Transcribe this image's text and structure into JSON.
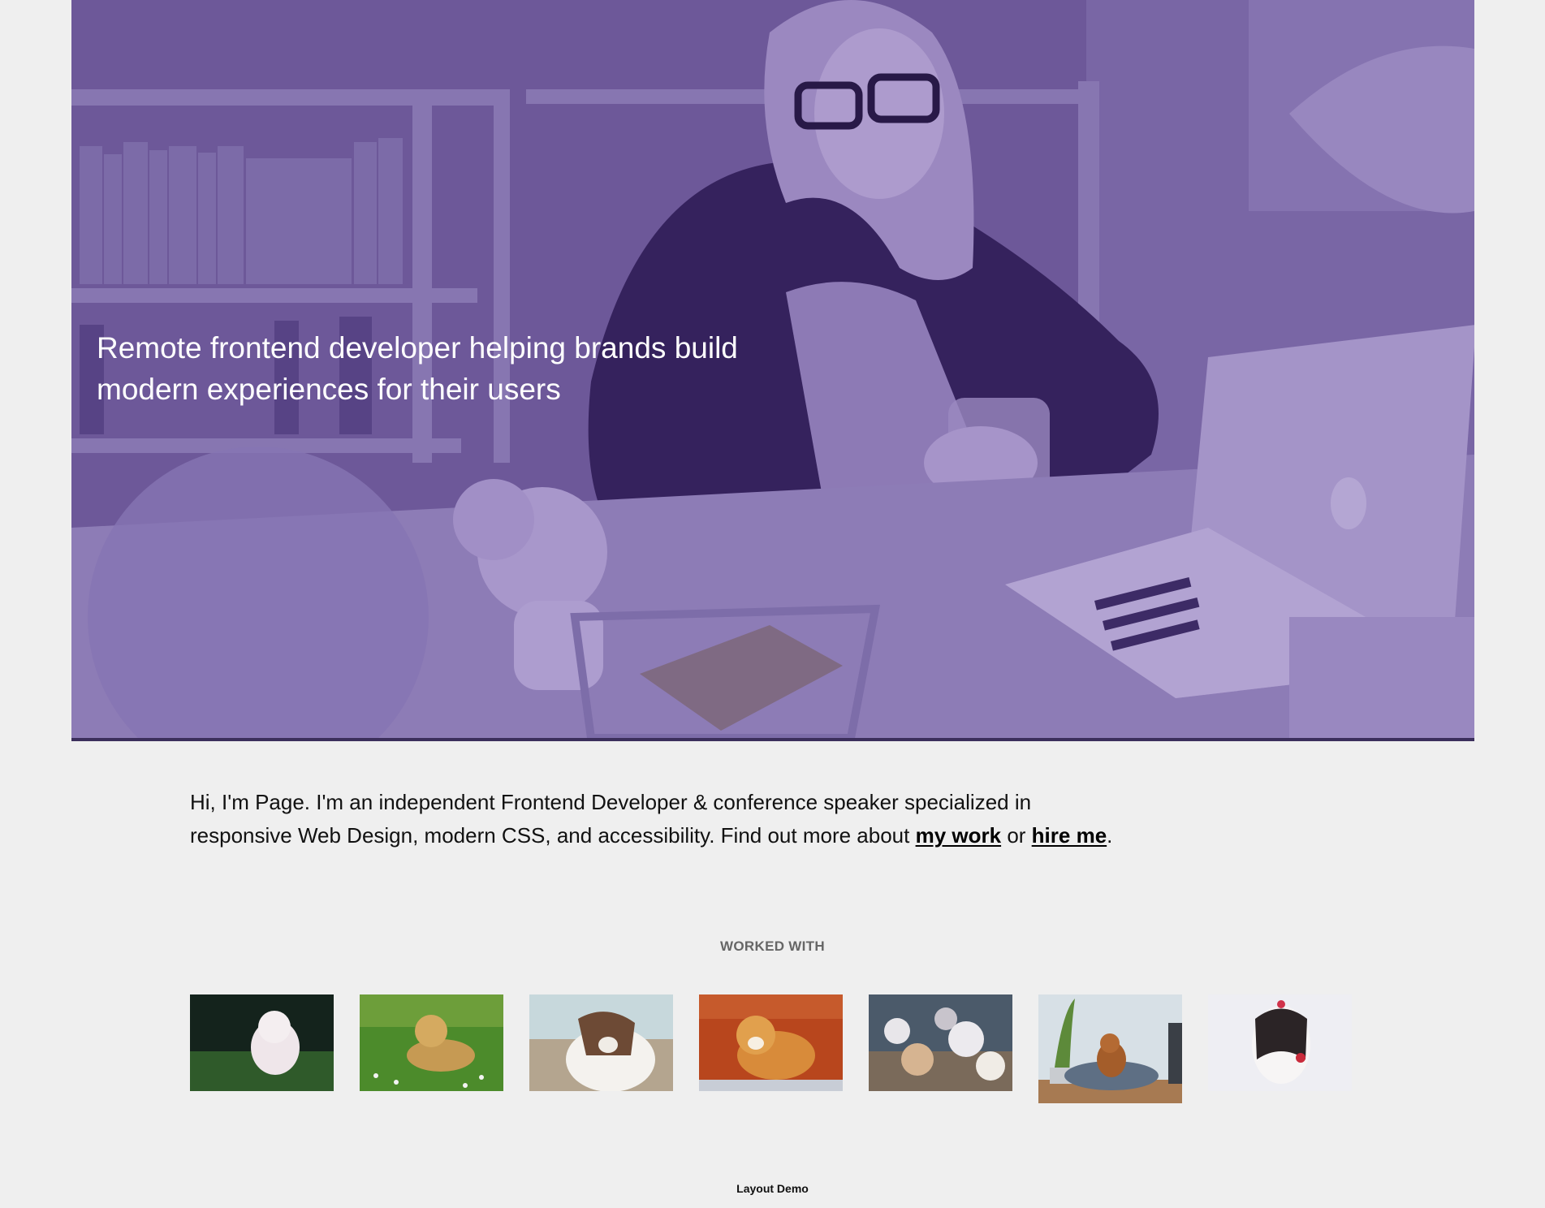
{
  "hero": {
    "title": "Remote frontend developer helping brands build modern experiences for their users",
    "image_icon": "woman-with-laptop-photo"
  },
  "intro": {
    "text_before": "Hi, I'm Page. I'm an independent Frontend Developer & conference speaker specialized in responsive Web Design, modern CSS, and accessibility. Find out more about ",
    "link_work": "my work",
    "text_middle": " or ",
    "link_hire": "hire me",
    "text_after": "."
  },
  "worked_with": {
    "title": "WORKED WITH",
    "logos": [
      {
        "icon": "white-puppy-running-photo"
      },
      {
        "icon": "golden-retriever-grass-photo"
      },
      {
        "icon": "border-collie-beach-photo"
      },
      {
        "icon": "corgi-orange-wall-photo"
      },
      {
        "icon": "puppies-on-steps-photo"
      },
      {
        "icon": "dog-on-bed-photo"
      },
      {
        "icon": "shih-tzu-white-photo"
      }
    ]
  },
  "footer": {
    "text": "Layout Demo"
  },
  "colors": {
    "background": "#efefef",
    "hero_tint": "#7a6a9c",
    "hero_border": "#3c2f5c"
  }
}
